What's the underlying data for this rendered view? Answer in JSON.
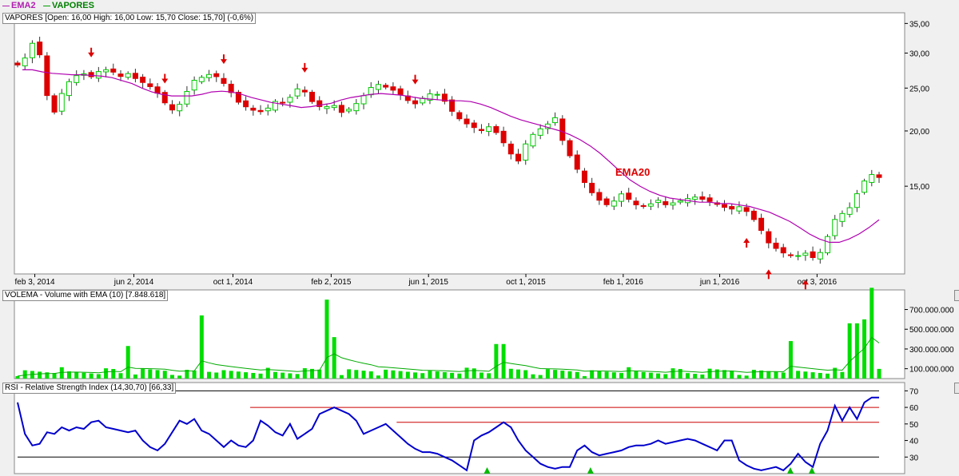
{
  "legend": [
    {
      "label": "EMA2",
      "color": "#b020b0"
    },
    {
      "label": "VAPORES",
      "color": "#00a000"
    }
  ],
  "panels": {
    "price_label": "VAPORES [Open: 16,00  High: 16,00  Low: 15,70  Close: 15,70] (-0,6%)",
    "volume_label": "VOLEMA - Volume with EMA (10) [7.848.618]",
    "rsi_label": "RSI - Relative Strength Index (14,30,70) [66,33]"
  },
  "annotations": {
    "ema_text": "EMA20"
  },
  "colors": {
    "up": "#00cc00",
    "down": "#dd0000",
    "ema": "#b000b0",
    "volume": "#00dd00",
    "rsi": "#0000cc",
    "rsi_level": "#000000",
    "rsi_resistance": "#cc0000",
    "arrow_down": "#dd0000",
    "arrow_up": "#dd0000",
    "rsi_marker": "#00bb00"
  },
  "chart_data": [
    {
      "type": "candlestick",
      "name": "VAPORES",
      "scale": "log",
      "ylim": [
        9.5,
        37
      ],
      "y_ticks": [
        35,
        30,
        25,
        20,
        15
      ],
      "y_tick_labels": [
        "35,00",
        "30,00",
        "25,00",
        "20,00",
        "15,00"
      ],
      "x_ticks": [
        "feb 3, 2014",
        "jun 2, 2014",
        "oct 1, 2014",
        "feb 2, 2015",
        "jun 1, 2015",
        "oct 1, 2015",
        "feb 1, 2016",
        "jun 1, 2016",
        "oct 3, 2016"
      ],
      "close_path": [
        28.2,
        29.5,
        33.0,
        24.5,
        22.0,
        25.0,
        26.5,
        27.0,
        26.5,
        27.5,
        27.5,
        26.5,
        27.0,
        26.0,
        25.5,
        24.5,
        23.0,
        22.0,
        24.0,
        26.0,
        26.5,
        27.0,
        26.0,
        24.5,
        23.0,
        22.5,
        22.0,
        22.5,
        23.5,
        23.0,
        25.0,
        24.5,
        23.0,
        22.5,
        23.0,
        22.0,
        22.5,
        23.5,
        25.0,
        25.5,
        25.0,
        24.5,
        23.5,
        23.0,
        24.0,
        24.5,
        23.5,
        22.0,
        21.0,
        20.5,
        20.0,
        20.5,
        19.5,
        18.0,
        17.0,
        19.0,
        20.0,
        20.5,
        21.5,
        18.5,
        17.0,
        15.5,
        14.5,
        13.8,
        13.5,
        14.5,
        14.0,
        13.5,
        13.5,
        14.0,
        13.6,
        13.8,
        14.0,
        14.2,
        14.0,
        13.8,
        13.5,
        13.3,
        13.5,
        13.0,
        12.2,
        11.2,
        10.8,
        10.5,
        10.4,
        10.6,
        10.3,
        10.8,
        12.5,
        13.0,
        13.5,
        15.0,
        16.0,
        15.7
      ],
      "ema_path": [
        27.5,
        27.5,
        27.2,
        27.0,
        26.9,
        26.8,
        26.8,
        26.7,
        26.6,
        26.4,
        26.0,
        25.6,
        25.0,
        24.5,
        24.2,
        24.0,
        24.0,
        24.0,
        24.2,
        24.5,
        24.6,
        24.5,
        24.2,
        23.8,
        23.5,
        23.2,
        23.0,
        22.8,
        22.6,
        22.7,
        22.9,
        23.1,
        23.5,
        23.8,
        24.0,
        24.2,
        24.3,
        24.2,
        24.1,
        23.9,
        23.7,
        23.6,
        23.5,
        23.4,
        23.4,
        23.3,
        23.0,
        22.6,
        22.1,
        21.6,
        21.2,
        20.9,
        20.6,
        20.3,
        20.0,
        19.6,
        19.1,
        18.5,
        17.8,
        17.0,
        16.2,
        15.5,
        15.0,
        14.6,
        14.3,
        14.1,
        14.0,
        13.9,
        13.8,
        13.8,
        13.7,
        13.7,
        13.6,
        13.5,
        13.3,
        13.1,
        12.8,
        12.5,
        12.1,
        11.7,
        11.4,
        11.2,
        11.2,
        11.4,
        11.7,
        12.1,
        12.6
      ],
      "down_arrows": [
        3,
        6,
        8.5,
        12,
        16.5
      ],
      "up_arrows": [
        30.5,
        31.5,
        33
      ],
      "last_close": 15.7
    },
    {
      "type": "bar",
      "name": "VOLEMA",
      "ylim": [
        0,
        850000000
      ],
      "y_ticks": [
        700000000,
        500000000,
        300000000,
        100000000
      ],
      "y_tick_labels": [
        "700.000.000",
        "500.000.000",
        "300.000.000",
        "100.000.000"
      ],
      "ema_last": 7848618,
      "spikes": [
        [
          0.13,
          330000000
        ],
        [
          0.21,
          640000000
        ],
        [
          0.36,
          800000000
        ],
        [
          0.37,
          420000000
        ],
        [
          0.56,
          350000000
        ],
        [
          0.9,
          380000000
        ],
        [
          0.97,
          560000000
        ],
        [
          0.985,
          600000000
        ],
        [
          0.99,
          920000000
        ]
      ]
    },
    {
      "type": "line",
      "name": "RSI",
      "ylim": [
        20,
        75
      ],
      "y_ticks": [
        70,
        60,
        50,
        40,
        30
      ],
      "y_tick_labels": [
        "70",
        "60",
        "50",
        "40",
        "30"
      ],
      "levels": [
        30,
        70
      ],
      "resistance_lines": [
        [
          0.27,
          1.0,
          60
        ],
        [
          0.44,
          1.0,
          51
        ]
      ],
      "last_value": 66.33,
      "values": [
        63,
        44,
        37,
        38,
        45,
        44,
        48,
        46,
        48,
        47,
        51,
        52,
        48,
        47,
        46,
        45,
        46,
        40,
        36,
        34,
        38,
        45,
        52,
        50,
        53,
        46,
        44,
        40,
        36,
        40,
        37,
        36,
        40,
        52,
        49,
        45,
        43,
        50,
        41,
        44,
        47,
        56,
        58,
        60,
        58,
        56,
        52,
        44,
        46,
        48,
        50,
        46,
        42,
        38,
        35,
        33,
        33,
        32,
        30,
        28,
        25,
        22,
        40,
        43,
        45,
        48,
        51,
        48,
        40,
        34,
        30,
        26,
        24,
        23,
        24,
        24,
        34,
        37,
        33,
        31,
        32,
        33,
        34,
        36,
        37,
        37,
        38,
        40,
        38,
        39,
        40,
        41,
        40,
        38,
        36,
        34,
        40,
        40,
        28,
        25,
        23,
        22,
        23,
        24,
        22,
        26,
        32,
        27,
        24,
        38,
        46,
        61,
        52,
        60,
        53,
        63,
        66,
        66
      ],
      "markers": [
        0.545,
        0.665,
        0.897,
        0.922
      ]
    }
  ]
}
